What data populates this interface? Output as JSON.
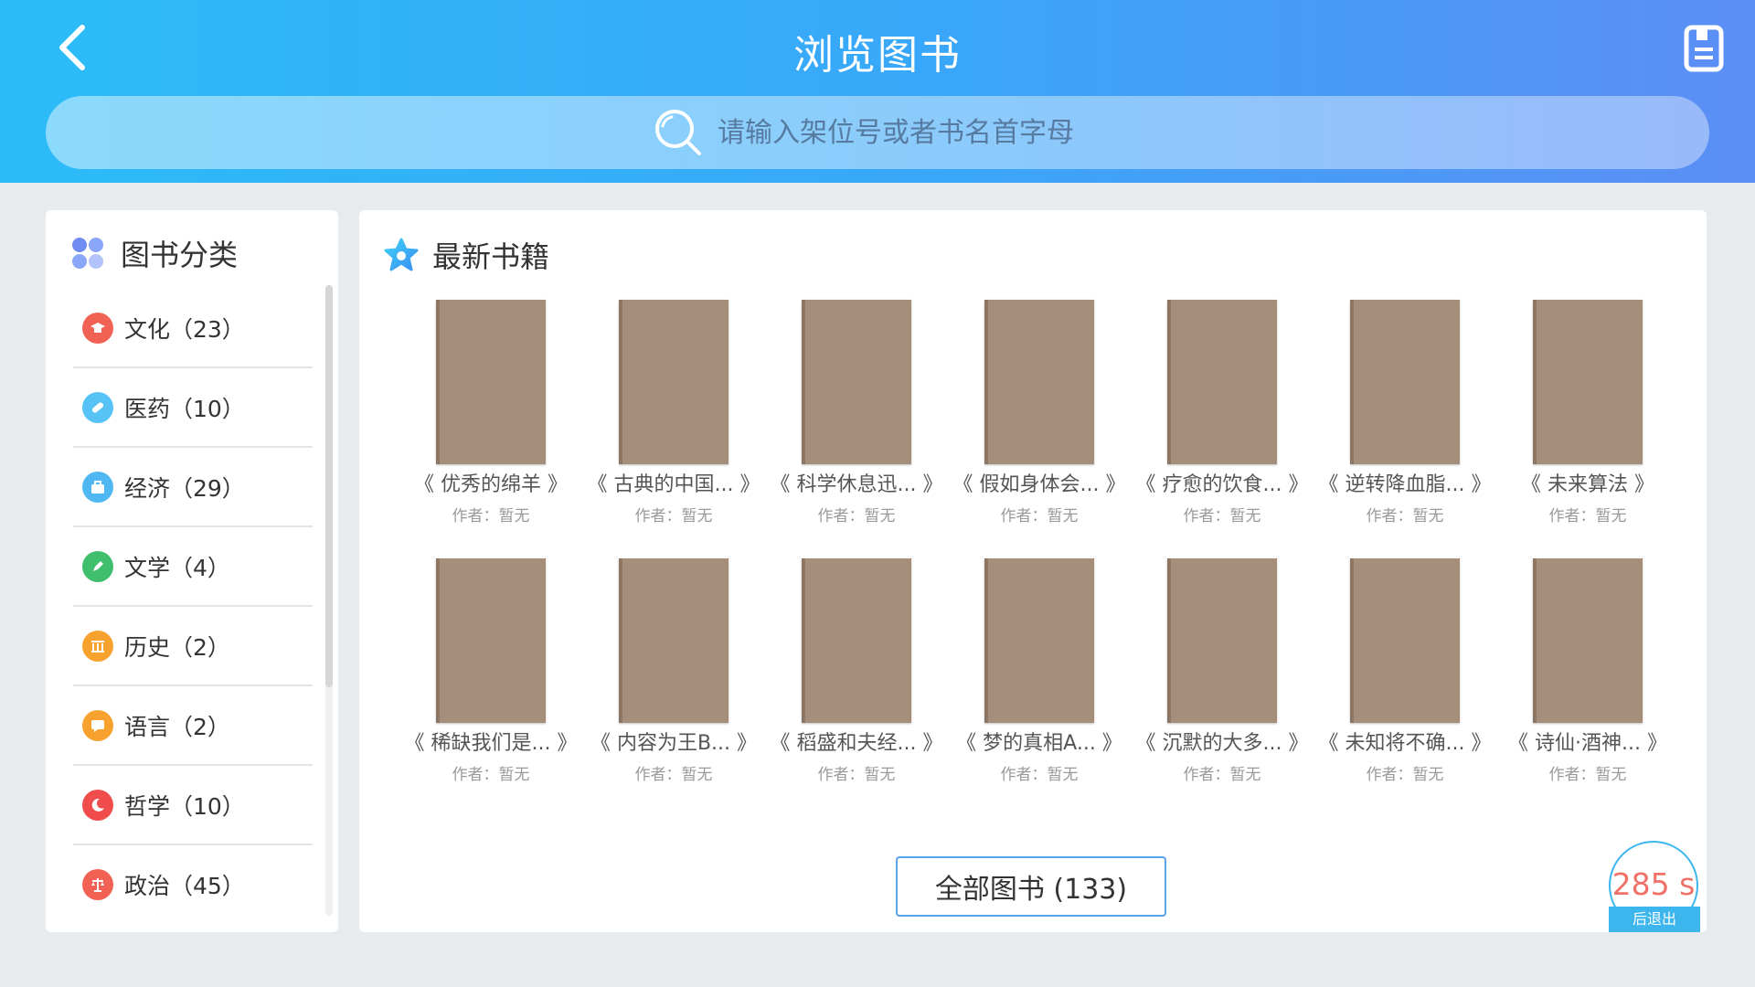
{
  "header": {
    "title": "浏览图书",
    "search_placeholder": "请输入架位号或者书名首字母"
  },
  "sidebar": {
    "title": "图书分类",
    "categories": [
      {
        "label": "文化（23）",
        "icon": "graduation-cap-icon",
        "color": "#f16254"
      },
      {
        "label": "医药（10）",
        "icon": "pill-icon",
        "color": "#56c2f5"
      },
      {
        "label": "经济（29）",
        "icon": "briefcase-icon",
        "color": "#4fb8f2"
      },
      {
        "label": "文学（4）",
        "icon": "pencil-icon",
        "color": "#3fbf6d"
      },
      {
        "label": "历史（2）",
        "icon": "columns-icon",
        "color": "#f7a22f"
      },
      {
        "label": "语言（2）",
        "icon": "speech-bubble-icon",
        "color": "#f7a22f"
      },
      {
        "label": "哲学（10）",
        "icon": "moon-icon",
        "color": "#f04c4c"
      },
      {
        "label": "政治（45）",
        "icon": "scale-icon",
        "color": "#f16254"
      }
    ]
  },
  "main": {
    "title": "最新书籍",
    "books": [
      {
        "title": "《 优秀的绵羊 》",
        "author": "作者：暂无"
      },
      {
        "title": "《 古典的中国... 》",
        "author": "作者：暂无"
      },
      {
        "title": "《 科学休息迅... 》",
        "author": "作者：暂无"
      },
      {
        "title": "《 假如身体会... 》",
        "author": "作者：暂无"
      },
      {
        "title": "《 疗愈的饮食... 》",
        "author": "作者：暂无"
      },
      {
        "title": "《 逆转降血脂... 》",
        "author": "作者：暂无"
      },
      {
        "title": "《 未来算法 》",
        "author": "作者：暂无"
      },
      {
        "title": "《 稀缺我们是... 》",
        "author": "作者：暂无"
      },
      {
        "title": "《 内容为王B... 》",
        "author": "作者：暂无"
      },
      {
        "title": "《 稻盛和夫经... 》",
        "author": "作者：暂无"
      },
      {
        "title": "《 梦的真相A... 》",
        "author": "作者：暂无"
      },
      {
        "title": "《 沉默的大多... 》",
        "author": "作者：暂无"
      },
      {
        "title": "《 未知将不确... 》",
        "author": "作者：暂无"
      },
      {
        "title": "《 诗仙·酒神... 》",
        "author": "作者：暂无"
      }
    ],
    "all_books_label": "全部图书 (133)"
  },
  "timer": {
    "value": "285 s",
    "label": "后退出"
  }
}
